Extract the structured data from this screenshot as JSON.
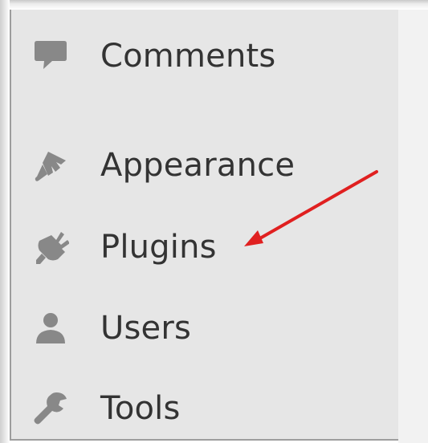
{
  "sidebar": {
    "items": [
      {
        "label": "Comments",
        "icon": "comment-icon"
      },
      {
        "label": "Appearance",
        "icon": "paintbrush-icon"
      },
      {
        "label": "Plugins",
        "icon": "plug-icon"
      },
      {
        "label": "Users",
        "icon": "user-icon"
      },
      {
        "label": "Tools",
        "icon": "wrench-icon"
      }
    ]
  },
  "colors": {
    "sidebar_bg": "#e6e6e6",
    "icon": "#888888",
    "label": "#333333",
    "annotation_arrow": "#e02020"
  }
}
